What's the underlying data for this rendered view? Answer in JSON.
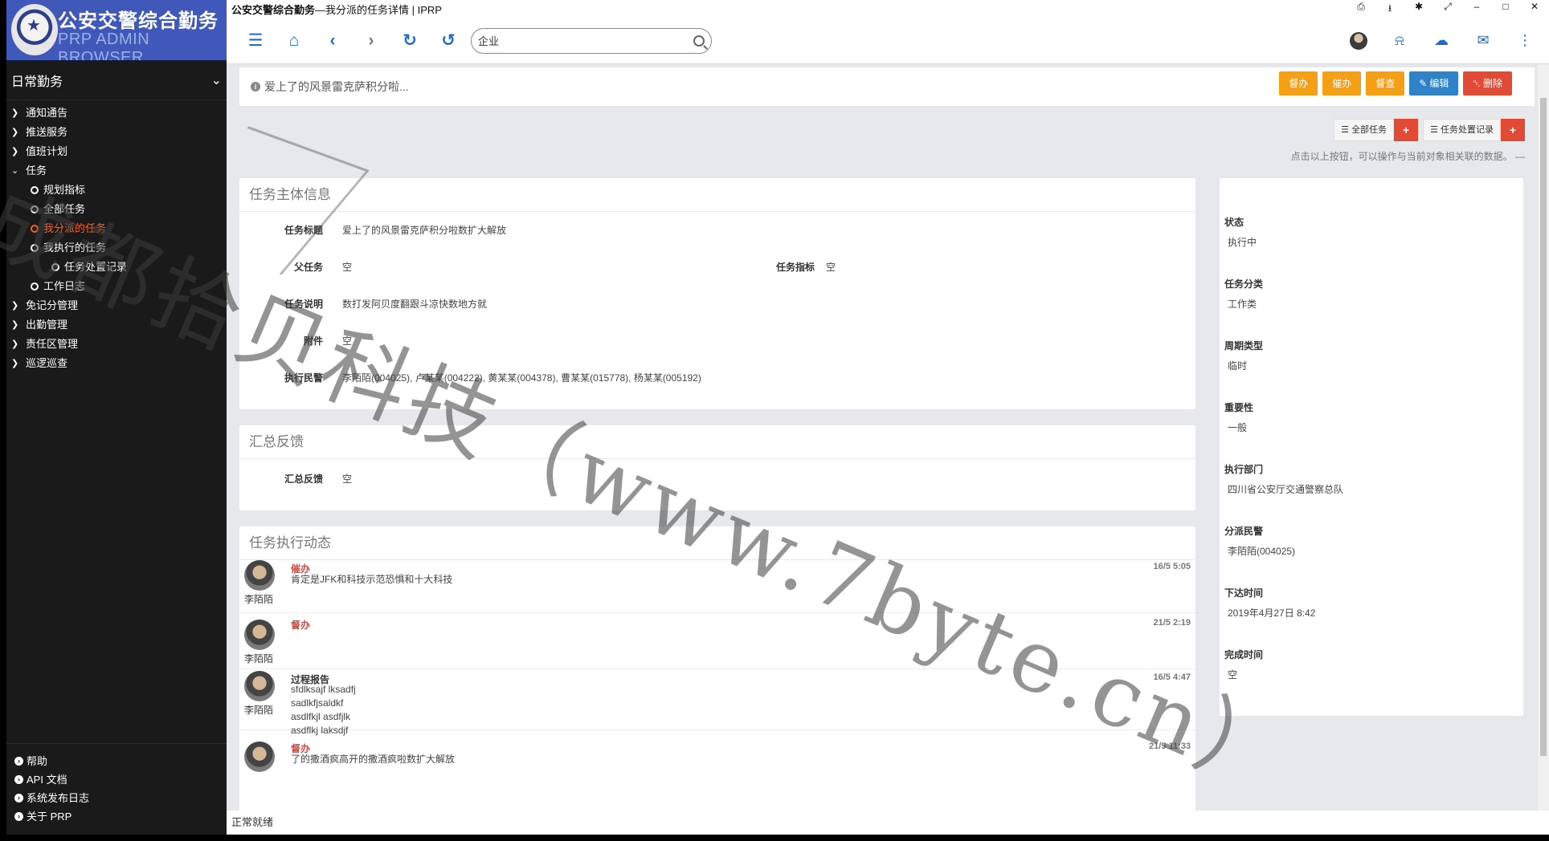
{
  "window": {
    "app_name": "公安交警综合勤务",
    "title_rest": " —我分派的任务详情 | IPRP"
  },
  "brand": {
    "name": "公安交警综合勤务",
    "subtitle": "PRP ADMIN BROWSER"
  },
  "sidebar": {
    "section_title": "日常勤务",
    "menu": [
      {
        "label": "通知通告",
        "level": 1
      },
      {
        "label": "推送服务",
        "level": 1
      },
      {
        "label": "值班计划",
        "level": 1
      },
      {
        "label": "任务",
        "level": 1
      },
      {
        "label": "规划指标",
        "level": 2
      },
      {
        "label": "全部任务",
        "level": 2
      },
      {
        "label": "我分派的任务",
        "level": 2,
        "active": true
      },
      {
        "label": "我执行的任务",
        "level": 2
      },
      {
        "label": "任务处置记录",
        "level": 3
      },
      {
        "label": "工作日志",
        "level": 2
      },
      {
        "label": "免记分管理",
        "level": 1
      },
      {
        "label": "出勤管理",
        "level": 1
      },
      {
        "label": "责任区管理",
        "level": 1
      },
      {
        "label": "巡逻巡查",
        "level": 1
      }
    ],
    "footer": [
      "帮助",
      "API 文档",
      "系统发布日志",
      "关于 PRP"
    ]
  },
  "toolbar": {
    "search_value": "企业"
  },
  "infobar": {
    "text": "爱上了的风景雷克萨积分啦..."
  },
  "actions": {
    "supervise": "督办",
    "urge": "催办",
    "inspect": "督查",
    "edit": "编辑",
    "delete": "删除"
  },
  "record_tools": {
    "all_tasks": "全部任务",
    "records": "任务处置记录",
    "hint": "点击以上按钮，可以操作与当前对象相关联的数据。 —"
  },
  "main_info": {
    "title": "任务主体信息",
    "task_title_label": "任务标题",
    "task_title_value": "爱上了的风景雷克萨积分啦数扩大解放",
    "parent_label": "父任务",
    "parent_value": "空",
    "indicator_label": "任务指标",
    "indicator_value": "空",
    "desc_label": "任务说明",
    "desc_value": "数打发阿贝度翻跟斗凉快数地方就",
    "attach_label": "附件",
    "attach_value": "空",
    "officers_label": "执行民警",
    "officers_value": "李陌陌(004025), 卢某某(004222), 黄某某(004378), 曹某某(015778), 杨某某(005192)"
  },
  "feedback": {
    "title": "汇总反馈",
    "label": "汇总反馈",
    "value": "空"
  },
  "activity": {
    "title": "任务执行动态",
    "items": [
      {
        "type": "催办",
        "style": "red",
        "user": "李陌陌",
        "time": "16/5 5:05",
        "lines": [
          "肯定是JFK和科技示范恐惧和十大科技"
        ]
      },
      {
        "type": "督办",
        "style": "red",
        "user": "李陌陌",
        "time": "21/5 2:19",
        "lines": []
      },
      {
        "type": "过程报告",
        "style": "dark",
        "user": "李陌陌",
        "time": "16/5 4:47",
        "lines": [
          "sfdlksajf lksadfj",
          "sadlkfjsaldkf",
          "asdlfkjl asdfjlk",
          "asdflkj laksdjf"
        ]
      },
      {
        "type": "督办",
        "style": "red",
        "user": "李陌陌",
        "time": "21/5 11:33",
        "lines": [
          "了的撒酒疯高开的撒酒疯啦数扩大解放"
        ]
      }
    ]
  },
  "side_panel": {
    "fields": [
      {
        "label": "状态",
        "value": "执行中"
      },
      {
        "label": "任务分类",
        "value": "工作类"
      },
      {
        "label": "周期类型",
        "value": "临时"
      },
      {
        "label": "重要性",
        "value": "一般"
      },
      {
        "label": "执行部门",
        "value": "四川省公安厅交通警察总队"
      },
      {
        "label": "分派民警",
        "value": "李陌陌(004025)"
      },
      {
        "label": "下达时间",
        "value": "2019年4月27日 8:42"
      },
      {
        "label": "完成时间",
        "value": "空"
      }
    ]
  },
  "statusbar": {
    "text": "正常就绪"
  },
  "watermark": {
    "text": "成都拾贝科技（www.7byte.cn）"
  },
  "colors": {
    "brand_blue": "#3f58b9",
    "sidebar_bg": "#1a1a1a",
    "active_menu": "#f0642d",
    "icon_blue": "#1e6ad1",
    "btn_orange": "#f59f15",
    "btn_blue": "#2f82c8",
    "btn_red": "#e14a35"
  }
}
